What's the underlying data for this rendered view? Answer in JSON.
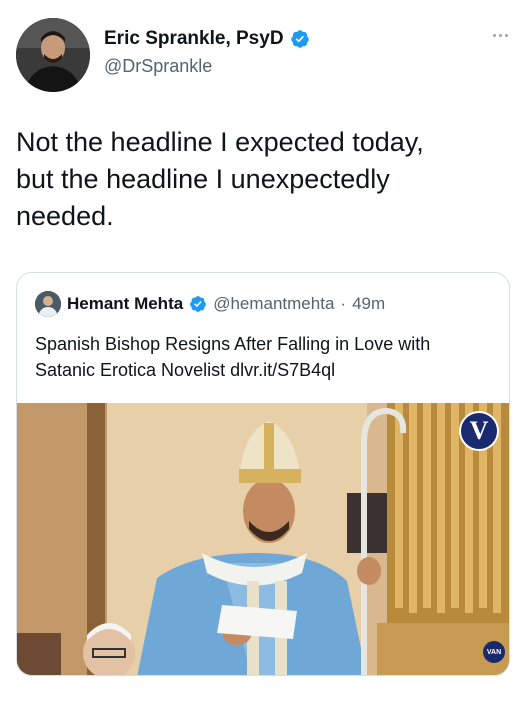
{
  "author": {
    "display_name": "Eric Sprankle, PsyD",
    "handle": "@DrSprankle",
    "verified": true
  },
  "tweet_text": "Not the headline I expected today,\nbut the headline I unexpectedly\nneeded.",
  "quoted_tweet": {
    "display_name": "Hemant Mehta",
    "handle": "@hemantmehta",
    "separator": "·",
    "time": "49m",
    "verified": true,
    "text": "Spanish Bishop Resigns After Falling in Love with Satanic Erotica Novelist dlvr.it/S7B4ql",
    "media": {
      "badge": "V",
      "corner_badge": "VAN"
    }
  },
  "colors": {
    "verified": "#1d9bf0",
    "secondary_text": "#536471",
    "primary_text": "#0f1419",
    "border": "#d7dde2"
  },
  "icons": {
    "more": "more-horizontal-icon",
    "verified": "verified-badge-icon"
  }
}
